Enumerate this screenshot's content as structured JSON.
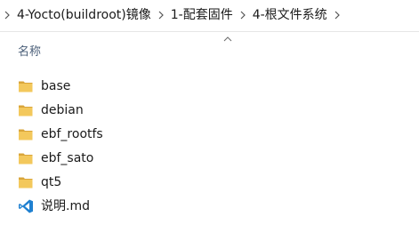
{
  "breadcrumb": {
    "items": [
      "4-Yocto(buildroot)镜像",
      "1-配套固件",
      "4-根文件系统"
    ]
  },
  "columns": {
    "name_header": "名称"
  },
  "files": [
    {
      "name": "base",
      "type": "folder",
      "icon": "folder-icon"
    },
    {
      "name": "debian",
      "type": "folder",
      "icon": "folder-icon"
    },
    {
      "name": "ebf_rootfs",
      "type": "folder",
      "icon": "folder-icon"
    },
    {
      "name": "ebf_sato",
      "type": "folder",
      "icon": "folder-icon"
    },
    {
      "name": "qt5",
      "type": "folder",
      "icon": "folder-icon"
    },
    {
      "name": "说明.md",
      "type": "file",
      "icon": "vscode-icon"
    }
  ],
  "colors": {
    "folder": "#e8b84a",
    "folder_dark": "#d9a53a",
    "vscode": "#1f80d0",
    "header_text": "#4c607a"
  }
}
